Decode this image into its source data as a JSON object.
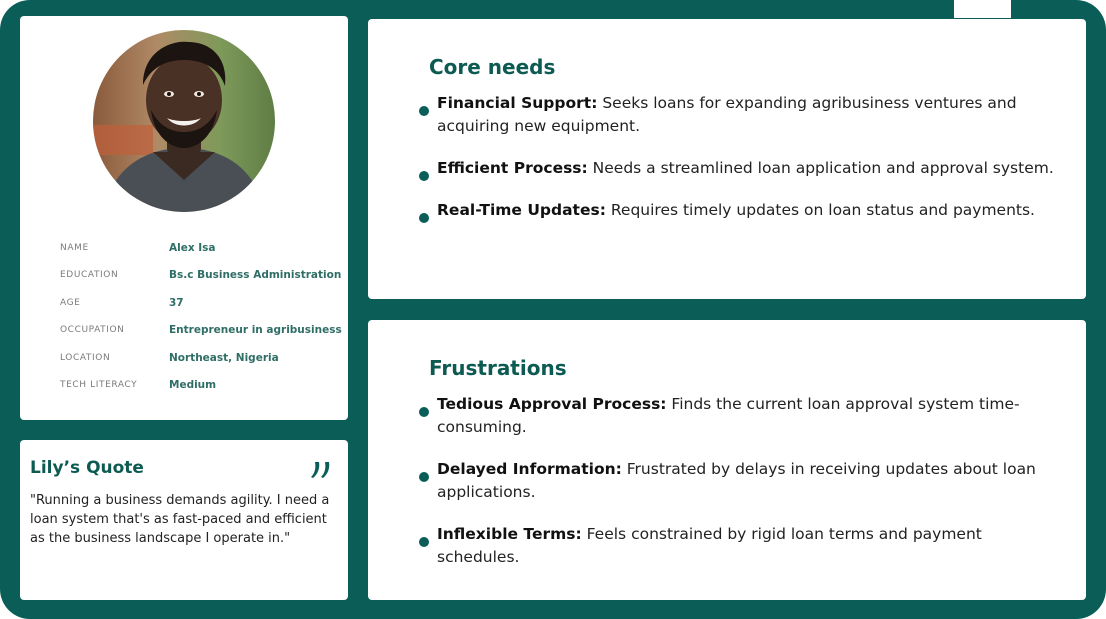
{
  "colors": {
    "brand": "#0a5e57",
    "card": "#ffffff",
    "accent_text": "#2f6e66"
  },
  "profile": {
    "avatar_icon": "person-photo",
    "fields": [
      {
        "label": "NAME",
        "value": "Alex Isa"
      },
      {
        "label": "EDUCATION",
        "value": "Bs.c Business Administration"
      },
      {
        "label": "AGE",
        "value": "37"
      },
      {
        "label": "OCCUPATION",
        "value": "Entrepreneur in agribusiness"
      },
      {
        "label": "LOCATION",
        "value": "Northeast, Nigeria"
      },
      {
        "label": "TECH  LITERACY",
        "value": "Medium"
      }
    ]
  },
  "quote": {
    "title": "Lily’s Quote",
    "icon": "quote-mark-icon",
    "text": "\"Running a business demands agility. I need a loan system that's as fast-paced and efficient as the business landscape I operate in.\""
  },
  "core_needs": {
    "title": "Core needs",
    "items": [
      {
        "term": "Financial Support:",
        "text": " Seeks loans for expanding agribusiness ventures and acquiring new equipment."
      },
      {
        "term": "Efficient Process:",
        "text": " Needs a streamlined loan application and approval system."
      },
      {
        "term": "Real-Time Updates:",
        "text": " Requires timely updates on loan status and payments."
      }
    ]
  },
  "frustrations": {
    "title": "Frustrations",
    "items": [
      {
        "term": "Tedious Approval Process:",
        "text": " Finds the current loan approval system time-consuming."
      },
      {
        "term": "Delayed Information:",
        "text": " Frustrated by delays in receiving updates about loan applications."
      },
      {
        "term": "Inflexible Terms:",
        "text": " Feels constrained by rigid loan terms and payment schedules."
      }
    ]
  }
}
